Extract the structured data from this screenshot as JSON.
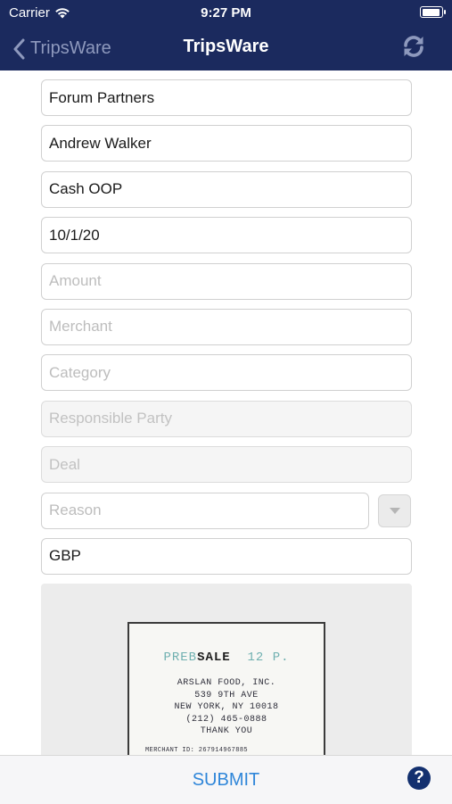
{
  "status_bar": {
    "carrier": "Carrier",
    "time": "9:27 PM"
  },
  "nav": {
    "back_label": "TripsWare",
    "title": "TripsWare",
    "refresh_icon": "refresh-icon"
  },
  "form": {
    "client": {
      "value": "Forum Partners"
    },
    "person": {
      "value": "Andrew Walker"
    },
    "payment_type": {
      "value": "Cash OOP"
    },
    "date": {
      "value": "10/1/20"
    },
    "amount": {
      "placeholder": "Amount"
    },
    "merchant": {
      "placeholder": "Merchant"
    },
    "category": {
      "placeholder": "Category"
    },
    "responsible_party": {
      "placeholder": "Responsible Party"
    },
    "deal": {
      "placeholder": "Deal"
    },
    "reason": {
      "placeholder": "Reason"
    },
    "currency": {
      "value": "GBP"
    }
  },
  "receipt": {
    "sale_prefix": "PREB",
    "sale_word": "SALE",
    "sale_suffix": "12 P.",
    "lines": [
      "ARSLAN FOOD, INC.",
      "539 9TH AVE",
      "NEW YORK, NY 10018",
      "(212) 465-0888",
      "THANK YOU"
    ],
    "merchant_id": "MERCHANT ID: 267914967885"
  },
  "bottom": {
    "submit_label": "SUBMIT",
    "help_label": "?"
  },
  "colors": {
    "nav_bg": "#1b2a5e",
    "accent": "#2f86d9",
    "help_bg": "#13306f"
  }
}
